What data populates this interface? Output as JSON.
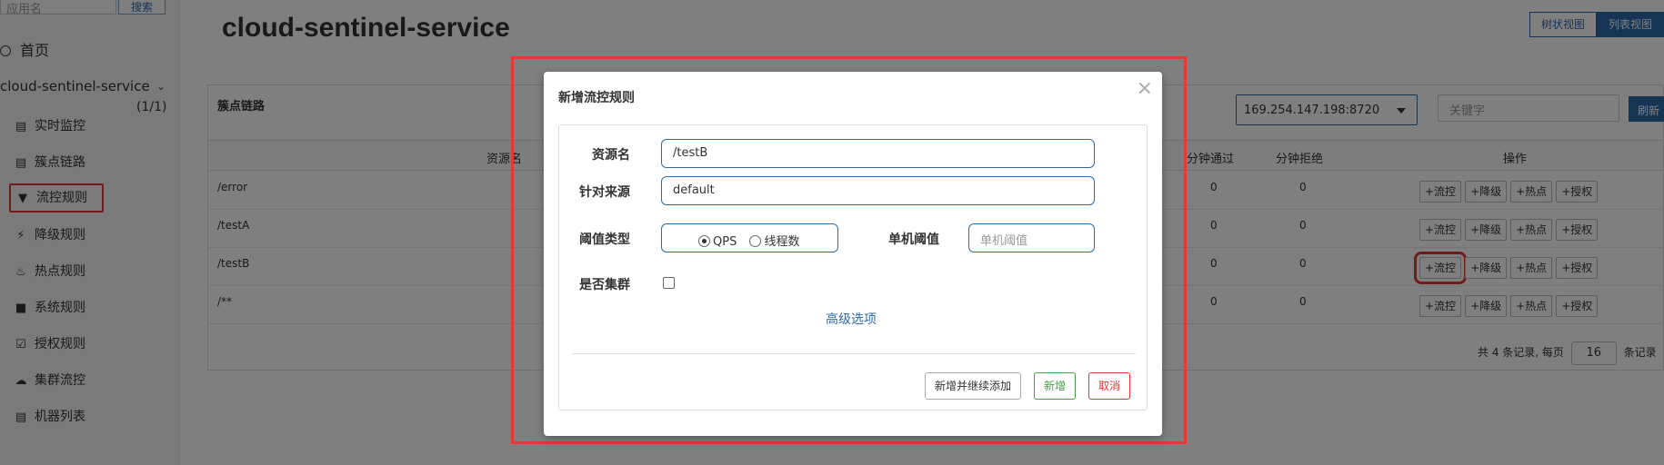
{
  "sidebar": {
    "search_placeholder": "应用名",
    "search_button": "搜索",
    "home": "首页",
    "app_name": "cloud-sentinel-service",
    "app_count": "(1/1)",
    "items": [
      {
        "label": "实时监控",
        "icon": "chart-bar-icon"
      },
      {
        "label": "簇点链路",
        "icon": "list-icon"
      },
      {
        "label": "流控规则",
        "icon": "filter-icon"
      },
      {
        "label": "降级规则",
        "icon": "bolt-icon"
      },
      {
        "label": "热点规则",
        "icon": "fire-icon"
      },
      {
        "label": "系统规则",
        "icon": "lock-icon"
      },
      {
        "label": "授权规则",
        "icon": "check-square-icon"
      },
      {
        "label": "集群流控",
        "icon": "cloud-icon"
      },
      {
        "label": "机器列表",
        "icon": "list-icon"
      }
    ]
  },
  "main": {
    "title": "cloud-sentinel-service",
    "view_tree": "树状视图",
    "view_list": "列表视图"
  },
  "panel": {
    "title": "簇点链路",
    "machine": "169.254.147.198:8720",
    "keyword_placeholder": "关键字",
    "refresh": "刷新",
    "columns": {
      "resource": "资源名",
      "pass_min": "分钟通过",
      "block_min": "分钟拒绝",
      "ops": "操作"
    },
    "rows": [
      {
        "resource": "/error",
        "pass": "0",
        "block": "0"
      },
      {
        "resource": "/testA",
        "pass": "0",
        "block": "0"
      },
      {
        "resource": "/testB",
        "pass": "0",
        "block": "0"
      },
      {
        "resource": "/**",
        "pass": "0",
        "block": "0"
      }
    ],
    "op_labels": {
      "flow": "+流控",
      "degrade": "+降级",
      "hot": "+热点",
      "auth": "+授权"
    },
    "pager": {
      "prefix": "共 4 条记录, 每页",
      "size": "16",
      "suffix": "条记录"
    }
  },
  "modal": {
    "title": "新增流控规则",
    "close": "×",
    "resource_label": "资源名",
    "resource_value": "/testB",
    "origin_label": "针对来源",
    "origin_value": "default",
    "threshold_type_label": "阈值类型",
    "qps": "QPS",
    "threads": "线程数",
    "single_threshold_label": "单机阈值",
    "single_threshold_placeholder": "单机阈值",
    "cluster_label": "是否集群",
    "advanced": "高级选项",
    "btn_add_continue": "新增并继续添加",
    "btn_add": "新增",
    "btn_cancel": "取消"
  },
  "colors": {
    "accent": "#2c6aa8",
    "highlight": "#e53935",
    "ok": "#43a047"
  }
}
